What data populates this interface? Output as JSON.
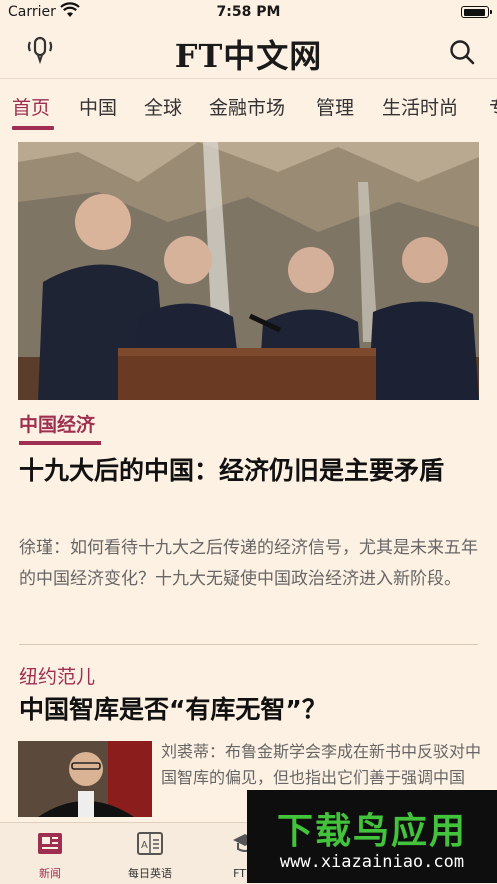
{
  "status_bar": {
    "carrier": "Carrier",
    "time": "7:58 PM",
    "battery_level": 0.95
  },
  "header": {
    "logo": "FT中文网",
    "audio_icon": "audio-icon",
    "search_icon": "search-icon"
  },
  "tabs": [
    {
      "label": "首页",
      "active": true
    },
    {
      "label": "中国",
      "active": false
    },
    {
      "label": "全球",
      "active": false
    },
    {
      "label": "金融市场",
      "active": false
    },
    {
      "label": "管理",
      "active": false
    },
    {
      "label": "生活时尚",
      "active": false
    },
    {
      "label": "专",
      "active": false
    }
  ],
  "articles": [
    {
      "section": "中国经济",
      "headline": "十九大后的中国：经济仍旧是主要矛盾",
      "summary": "徐瑾：如何看待十九大之后传递的经济信号，尤其是未来五年的中国经济变化？十九大无疑使中国政治经济进入新阶段。"
    },
    {
      "section": "纽约范儿",
      "headline": "中国智库是否“有库无智”？",
      "summary": "刘裘蒂：布鲁金斯学会李成在新书中反驳对中国智库的偏见，但也指出它们善于强调中国"
    }
  ],
  "bottom_nav": [
    {
      "label": "新闻",
      "icon": "news-icon",
      "active": true
    },
    {
      "label": "每日英语",
      "icon": "english-icon",
      "active": false
    },
    {
      "label": "FT商",
      "icon": "academy-icon",
      "active": false
    }
  ],
  "watermark": {
    "main": "下载鸟应用",
    "url": "www.xiazainiao.com"
  },
  "colors": {
    "accent": "#9e2f50",
    "background": "#fdf1e3",
    "watermark_green": "#43c23c"
  }
}
